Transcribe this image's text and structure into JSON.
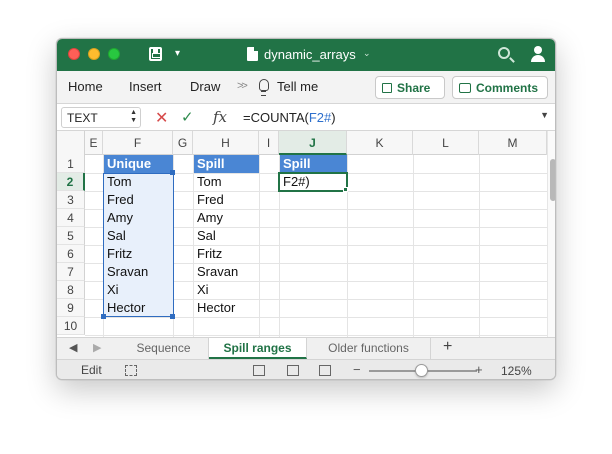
{
  "window": {
    "title": "dynamic_arrays"
  },
  "ribbon": {
    "tabs": [
      "Home",
      "Insert",
      "Draw",
      "Tell me"
    ],
    "share_label": "Share",
    "comments_label": "Comments"
  },
  "formula_bar": {
    "name_box": "TEXT",
    "formula_prefix": "=COUNTA(",
    "formula_ref": "F2#",
    "formula_suffix": ")"
  },
  "grid": {
    "columns": [
      "E",
      "F",
      "G",
      "H",
      "I",
      "J",
      "K",
      "L",
      "M"
    ],
    "rows": [
      "1",
      "2",
      "3",
      "4",
      "5",
      "6",
      "7",
      "8",
      "9",
      "10"
    ],
    "active_column": "J",
    "active_row": "2",
    "col_f": [
      "Unique",
      "Tom",
      "Fred",
      "Amy",
      "Sal",
      "Fritz",
      "Sravan",
      "Xi",
      "Hector"
    ],
    "col_h": [
      "Spill",
      "Tom",
      "Fred",
      "Amy",
      "Sal",
      "Fritz",
      "Sravan",
      "Xi",
      "Hector"
    ],
    "col_j": [
      "Spill",
      "F2#)"
    ]
  },
  "sheets": {
    "tabs": [
      "Sequence",
      "Spill ranges",
      "Older functions"
    ],
    "active": "Spill ranges"
  },
  "status": {
    "mode": "Edit",
    "zoom": "125%"
  },
  "colors": {
    "excel_green": "#217346",
    "header_blue": "#4a86d4",
    "spill_border": "#2f6cc0"
  }
}
